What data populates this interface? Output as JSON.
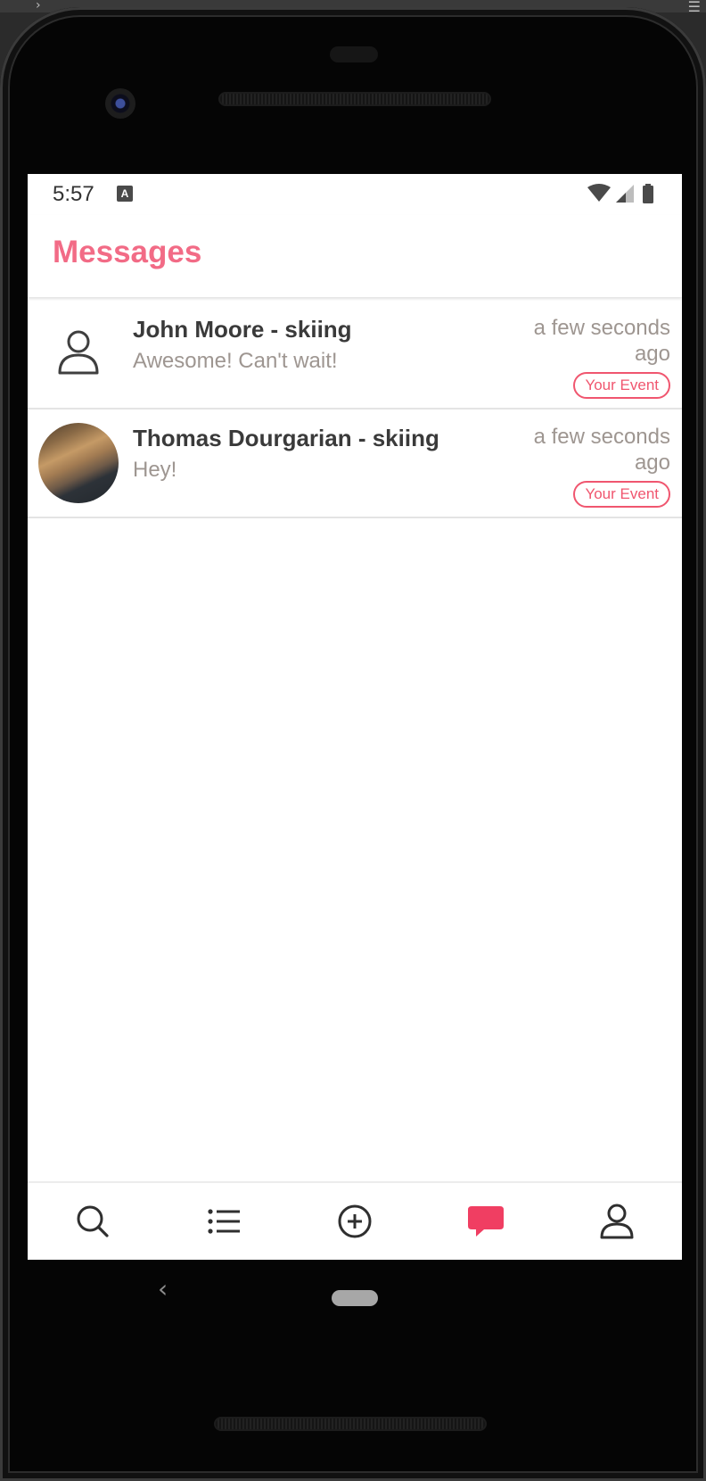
{
  "status_bar": {
    "time": "5:57",
    "keyboard_indicator": "A"
  },
  "header": {
    "title": "Messages"
  },
  "conversations": [
    {
      "name": "John Moore - skiing",
      "last_message": "Awesome! Can't wait!",
      "time": "a few seconds ago",
      "badge": "Your Event",
      "avatar": "person-outline-icon"
    },
    {
      "name": "Thomas Dourgarian - skiing",
      "last_message": "Hey!",
      "time": "a few seconds ago",
      "badge": "Your Event",
      "avatar": "user-photo"
    }
  ],
  "tab_bar": {
    "tabs": [
      {
        "icon": "search-icon",
        "active": false
      },
      {
        "icon": "list-icon",
        "active": false
      },
      {
        "icon": "add-circle-icon",
        "active": false
      },
      {
        "icon": "chat-bubble-icon",
        "active": true
      },
      {
        "icon": "profile-icon",
        "active": false
      }
    ]
  },
  "colors": {
    "brand_accent": "#f26b86",
    "badge_accent": "#f0566f",
    "active_tab": "#f03e62",
    "muted_text": "#9e9691",
    "primary_text": "#3a3a3a"
  }
}
